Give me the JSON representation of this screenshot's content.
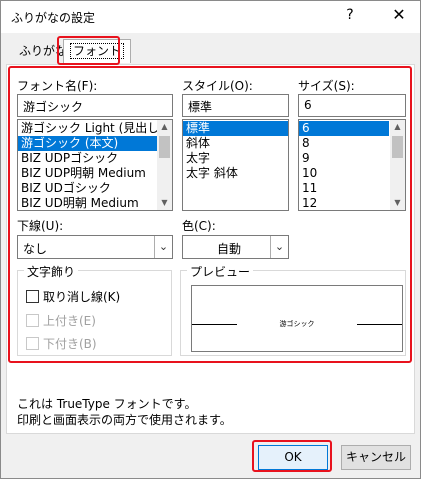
{
  "window": {
    "title": "ふりがなの設定",
    "help_glyph": "?",
    "close_glyph": "✕"
  },
  "tabs": [
    {
      "label": "ふりがな",
      "active": false
    },
    {
      "label": "フォント",
      "active": true
    }
  ],
  "font_name": {
    "label": "フォント名(F):",
    "value": "游ゴシック",
    "items": [
      "游ゴシック Light (見出し)",
      "游ゴシック (本文)",
      "BIZ UDPゴシック",
      "BIZ UDP明朝 Medium",
      "BIZ UDゴシック",
      "BIZ UD明朝 Medium"
    ],
    "selected_index": 1
  },
  "style": {
    "label": "スタイル(O):",
    "value": "標準",
    "items": [
      "標準",
      "斜体",
      "太字",
      "太字 斜体"
    ],
    "selected_index": 0
  },
  "size": {
    "label": "サイズ(S):",
    "value": "6",
    "items": [
      "6",
      "8",
      "9",
      "10",
      "11",
      "12"
    ],
    "selected_index": 0
  },
  "underline": {
    "label": "下線(U):",
    "value": "なし"
  },
  "color": {
    "label": "色(C):",
    "value": "自動"
  },
  "effects": {
    "title": "文字飾り",
    "strikethrough": "取り消し線(K)",
    "superscript": "上付き(E)",
    "subscript": "下付き(B)"
  },
  "preview": {
    "title": "プレビュー",
    "sample": "游ゴシック"
  },
  "info": {
    "line1": "これは TrueType フォントです。",
    "line2": "印刷と画面表示の両方で使用されます。"
  },
  "buttons": {
    "ok": "OK",
    "cancel": "キャンセル"
  },
  "colors": {
    "highlight": "#e8121d",
    "selection": "#0078d7"
  }
}
